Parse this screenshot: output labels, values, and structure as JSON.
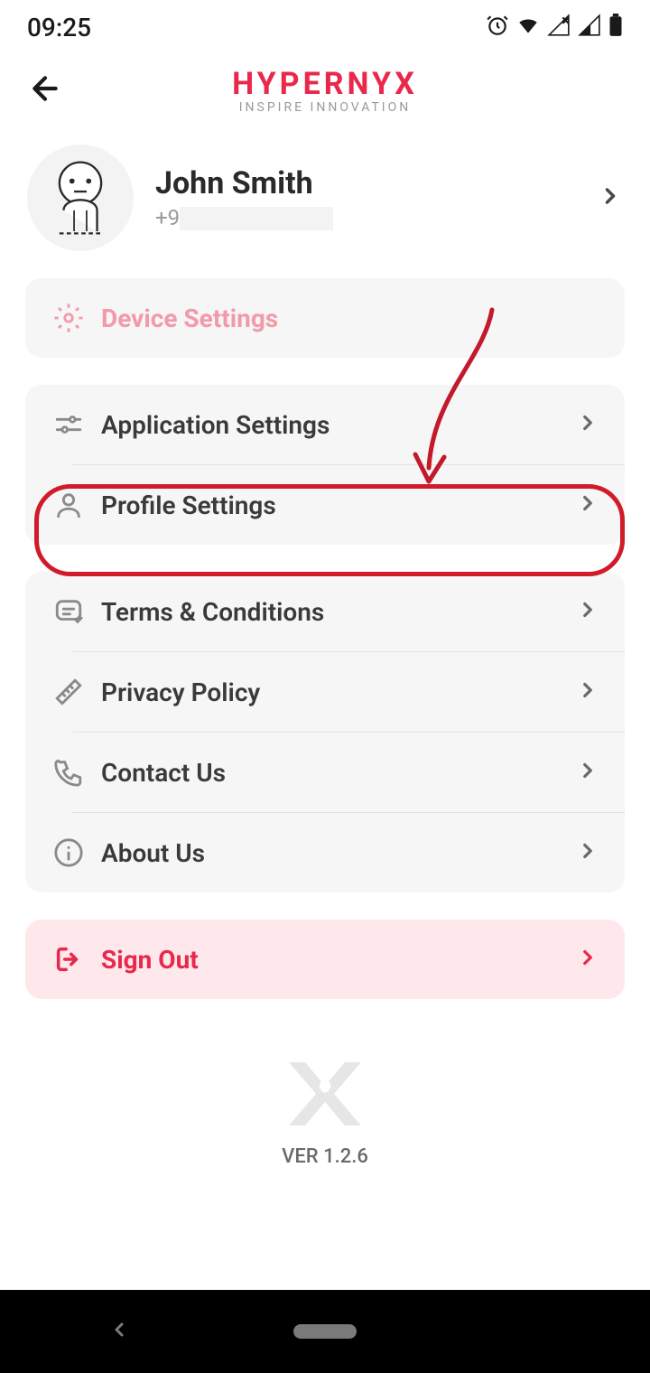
{
  "status": {
    "time": "09:25"
  },
  "brand": {
    "title": "HYPERNYX",
    "subtitle": "INSPIRE INNOVATION"
  },
  "profile": {
    "name": "John Smith",
    "phone_prefix": "+9"
  },
  "menu": {
    "device_settings": "Device Settings",
    "application_settings": "Application Settings",
    "profile_settings": "Profile Settings",
    "terms": "Terms & Conditions",
    "privacy": "Privacy Policy",
    "contact": "Contact Us",
    "about": "About Us",
    "signout": "Sign Out"
  },
  "version": "VER 1.2.6",
  "colors": {
    "accent": "#e8294c",
    "highlight": "#d11a2a"
  }
}
